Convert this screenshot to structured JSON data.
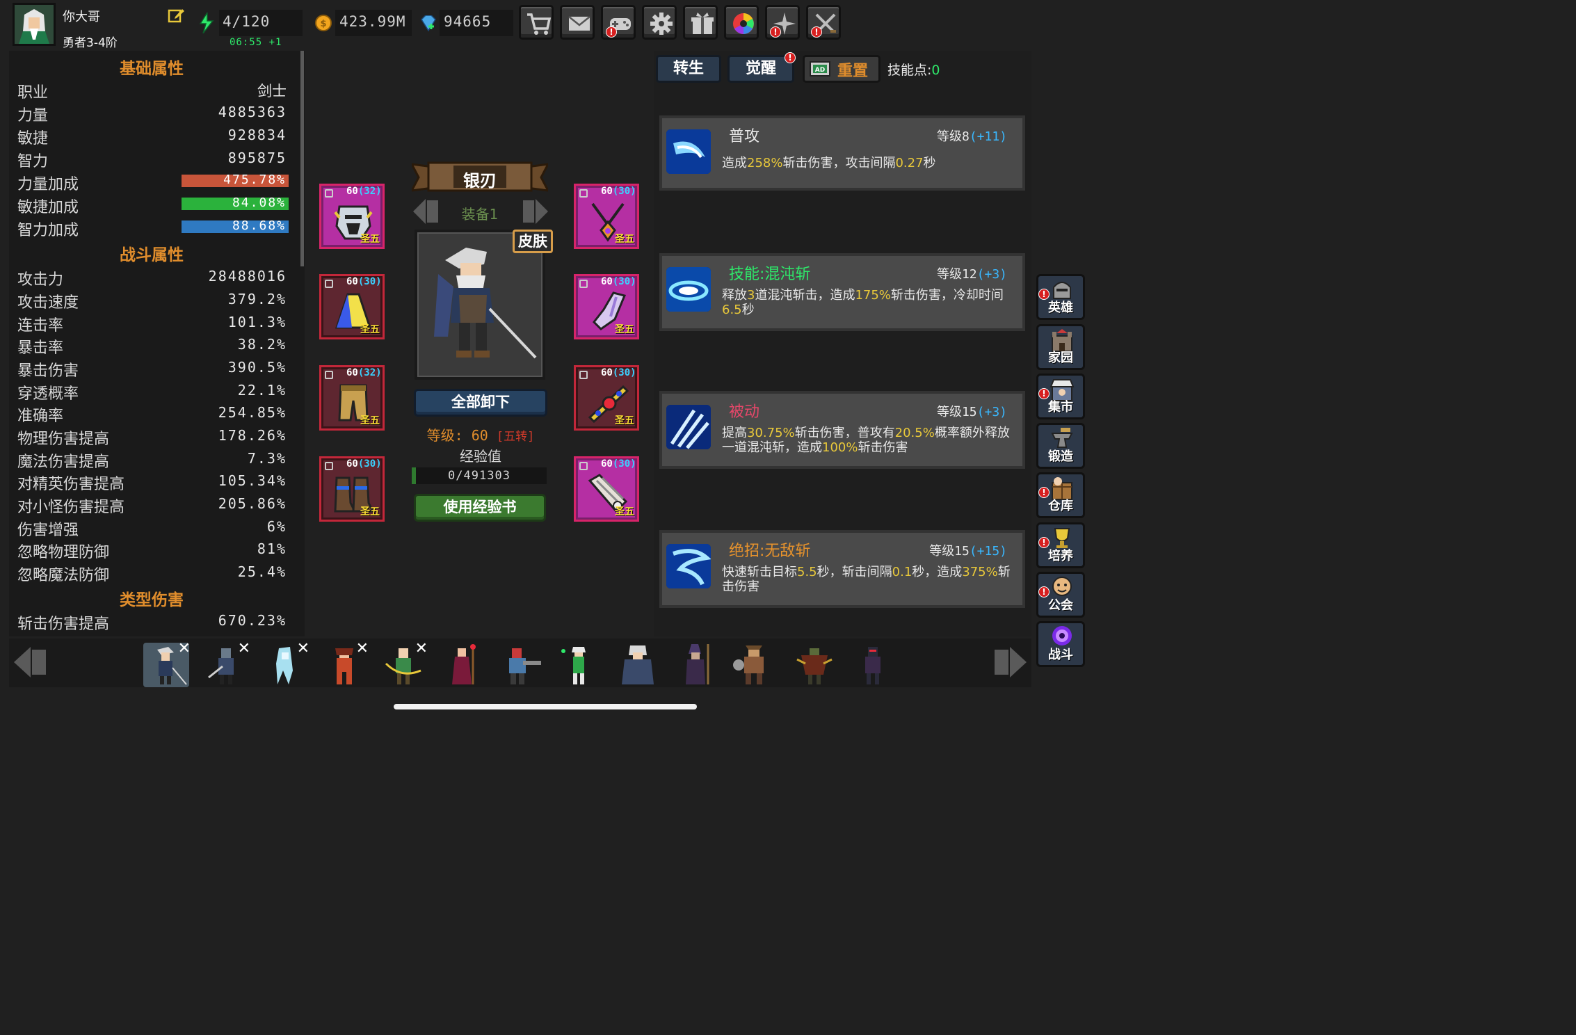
{
  "player": {
    "name": "你大哥",
    "rank": "勇者3-4阶"
  },
  "resources": {
    "stamina": "4/120",
    "stamina_timer": "06:55 +1",
    "gold": "423.99M",
    "gems": "94665"
  },
  "top_buttons": [
    {
      "icon": "shop-cart-icon"
    },
    {
      "icon": "mail-icon"
    },
    {
      "icon": "gamepad-icon",
      "alert": "!"
    },
    {
      "icon": "gear-icon"
    },
    {
      "icon": "gift-icon"
    },
    {
      "icon": "color-wheel-icon"
    },
    {
      "icon": "sparkle-icon",
      "alert": "!"
    },
    {
      "icon": "crossed-swords-icon",
      "alert": "!"
    }
  ],
  "stats": {
    "basic_title": "基础属性",
    "basic": [
      {
        "label": "职业",
        "value": "剑士"
      },
      {
        "label": "力量",
        "value": "4885363"
      },
      {
        "label": "敏捷",
        "value": "928834"
      },
      {
        "label": "智力",
        "value": "895875"
      }
    ],
    "bonus": [
      {
        "label": "力量加成",
        "value": "475.78%",
        "color": "#c8553a"
      },
      {
        "label": "敏捷加成",
        "value": "84.08%",
        "color": "#2bb23c"
      },
      {
        "label": "智力加成",
        "value": "88.68%",
        "color": "#2f7ac2"
      }
    ],
    "combat_title": "战斗属性",
    "combat": [
      {
        "label": "攻击力",
        "value": "28488016"
      },
      {
        "label": "攻击速度",
        "value": "379.2%"
      },
      {
        "label": "连击率",
        "value": "101.3%"
      },
      {
        "label": "暴击率",
        "value": "38.2%"
      },
      {
        "label": "暴击伤害",
        "value": "390.5%"
      },
      {
        "label": "穿透概率",
        "value": "22.1%"
      },
      {
        "label": "准确率",
        "value": "254.85%"
      },
      {
        "label": "物理伤害提高",
        "value": "178.26%"
      },
      {
        "label": "魔法伤害提高",
        "value": "7.3%"
      },
      {
        "label": "对精英伤害提高",
        "value": "105.34%"
      },
      {
        "label": "对小怪伤害提高",
        "value": "205.86%"
      },
      {
        "label": "伤害增强",
        "value": "6%"
      },
      {
        "label": "忽略物理防御",
        "value": "81%"
      },
      {
        "label": "忽略魔法防御",
        "value": "25.4%"
      }
    ],
    "type_title": "类型伤害",
    "type": [
      {
        "label": "斩击伤害提高",
        "value": "670.23%"
      }
    ]
  },
  "equipment": {
    "weapon_name": "银刃",
    "loadout": "装备1",
    "skin_label": "皮肤",
    "unequip_label": "全部卸下",
    "level_text": "等级: 60",
    "transcend_text": "[五转]",
    "exp_label": "经验值",
    "exp_value": "0/491303",
    "expbook_label": "使用经验书",
    "slots": [
      {
        "level": "60",
        "sub": "(32)",
        "tag": "圣五",
        "item": "helmet-icon"
      },
      {
        "level": "60",
        "sub": "(30)",
        "tag": "圣五",
        "item": "cloak-icon"
      },
      {
        "level": "60",
        "sub": "(32)",
        "tag": "圣五",
        "item": "armor-icon"
      },
      {
        "level": "60",
        "sub": "(30)",
        "tag": "圣五",
        "item": "boots-icon"
      },
      {
        "level": "60",
        "sub": "(30)",
        "tag": "圣五",
        "item": "necklace-icon"
      },
      {
        "level": "60",
        "sub": "(30)",
        "tag": "圣五",
        "item": "gauntlet-icon"
      },
      {
        "level": "60",
        "sub": "(30)",
        "tag": "圣五",
        "item": "ring-icon"
      },
      {
        "level": "60",
        "sub": "(30)",
        "tag": "圣五",
        "item": "bracer-icon"
      }
    ]
  },
  "skills_panel": {
    "tab_rebirth": "转生",
    "tab_awaken": "觉醒",
    "tab_reset": "重置",
    "skill_points_label": "技能点:",
    "skill_points": "0",
    "skills": [
      {
        "name": "普攻",
        "name_color": "#e8e8e8",
        "level": "等级8",
        "plus": "(+11)",
        "desc_parts": [
          "造成",
          "258%",
          "斩击伤害，攻击间隔",
          "0.27",
          "秒"
        ]
      },
      {
        "name": "技能:混沌斩",
        "name_color": "#2ee86a",
        "level": "等级12",
        "plus": "(+3)",
        "desc_parts": [
          "释放",
          "3",
          "道混沌斩击，造成",
          "175%",
          "斩击伤害，冷却时间",
          "6.5",
          "秒"
        ]
      },
      {
        "name": "被动",
        "name_color": "#e8476a",
        "level": "等级15",
        "plus": "(+3)",
        "desc_parts": [
          "提高",
          "30.75%",
          "斩击伤害，普攻有",
          "20.5%",
          "概率额外释放一道混沌斩，造成",
          "100%",
          "斩击伤害"
        ]
      },
      {
        "name": "绝招:无敌斩",
        "name_color": "#e8932c",
        "level": "等级15",
        "plus": "(+15)",
        "desc_parts": [
          "快速斩击目标",
          "5.5",
          "秒，斩击间隔",
          "0.1",
          "秒，造成",
          "375%",
          "斩击伤害"
        ]
      }
    ]
  },
  "side_nav": [
    {
      "label": "英雄",
      "icon": "hero-helmet-icon",
      "alert": "!"
    },
    {
      "label": "家园",
      "icon": "castle-icon"
    },
    {
      "label": "集市",
      "icon": "market-icon",
      "alert": "!"
    },
    {
      "label": "锻造",
      "icon": "anvil-icon"
    },
    {
      "label": "仓库",
      "icon": "warehouse-icon",
      "alert": "!"
    },
    {
      "label": "培养",
      "icon": "trophy-icon",
      "alert": "!"
    },
    {
      "label": "公会",
      "icon": "guild-icon",
      "alert": "!"
    },
    {
      "label": "战斗",
      "icon": "portal-icon"
    }
  ],
  "heroes": [
    {
      "name": "hero-swordsman",
      "removable": true,
      "selected": true
    },
    {
      "name": "hero-knight",
      "removable": true
    },
    {
      "name": "hero-ghost",
      "removable": true
    },
    {
      "name": "hero-warrior-woman",
      "removable": true
    },
    {
      "name": "hero-archer",
      "removable": true
    },
    {
      "name": "hero-sorceress",
      "removable": false
    },
    {
      "name": "hero-gunner",
      "removable": false
    },
    {
      "name": "hero-elf",
      "removable": false
    },
    {
      "name": "hero-wizard",
      "removable": false
    },
    {
      "name": "hero-mage",
      "removable": false
    },
    {
      "name": "hero-berserker",
      "removable": false
    },
    {
      "name": "hero-hunter",
      "removable": false
    },
    {
      "name": "hero-assassin",
      "removable": false
    }
  ],
  "colors": {
    "accent_orange": "#e08d2c",
    "equip_border": "#d7246a",
    "green": "#2ee86a",
    "blue_text": "#3ab8ff"
  }
}
